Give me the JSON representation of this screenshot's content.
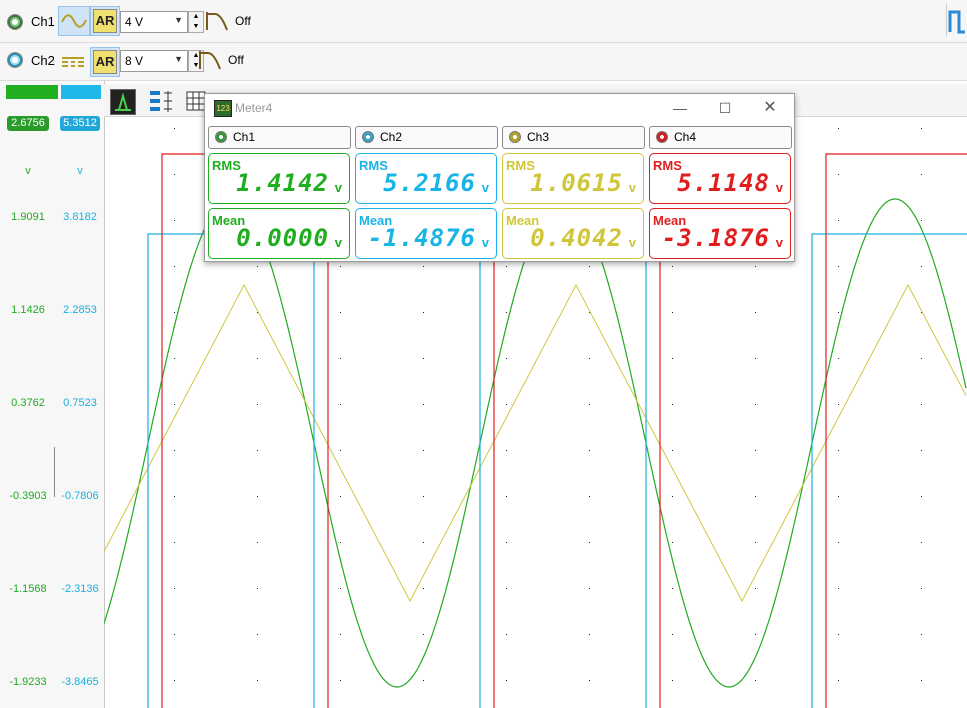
{
  "channel_controls": [
    {
      "name": "Ch1",
      "voltage": "4 V",
      "filter": "Off",
      "ar": "AR"
    },
    {
      "name": "Ch2",
      "voltage": "8 V",
      "filter": "Off",
      "ar": "AR"
    }
  ],
  "scale_panel": {
    "ch1_value": "2.6756",
    "ch2_value": "5.3512",
    "ch1_unit": "v",
    "ch2_unit": "v",
    "ch1_ticks": [
      "1.9091",
      "1.1426",
      "0.3762",
      "-0.3903",
      "-1.1568",
      "-1.9233"
    ],
    "ch2_ticks": [
      "3.8182",
      "2.2853",
      "0.7523",
      "-0.7806",
      "-2.3136",
      "-3.8465"
    ],
    "ch1_color": "#22aa22",
    "ch2_color": "#1ab0e0"
  },
  "meter": {
    "title": "Meter4",
    "channels": [
      {
        "label": "Ch1",
        "color": "#1fae1f",
        "led": "#3a9a3a",
        "rms_label": "RMS",
        "rms": "1.4142",
        "mean_label": "Mean",
        "mean": "0.0000",
        "unit": "v"
      },
      {
        "label": "Ch2",
        "color": "#19b4e6",
        "led": "#3aa0c0",
        "rms_label": "RMS",
        "rms": "5.2166",
        "mean_label": "Mean",
        "mean": "-1.4876",
        "unit": "v"
      },
      {
        "label": "Ch3",
        "color": "#d0c63a",
        "led": "#b0a030",
        "rms_label": "RMS",
        "rms": "1.0615",
        "mean_label": "Mean",
        "mean": "0.4042",
        "unit": "v"
      },
      {
        "label": "Ch4",
        "color": "#e01e1e",
        "led": "#d02020",
        "rms_label": "RMS",
        "rms": "5.1148",
        "mean_label": "Mean",
        "mean": "-3.1876",
        "unit": "v"
      }
    ]
  },
  "icons": {
    "minimize": "minimize-icon",
    "maximize": "maximize-icon",
    "close": "close-icon",
    "sine": "sine-wave-icon",
    "filter": "lowpass-filter-icon"
  },
  "colors": {
    "ch1": "#22aa22",
    "ch2": "#1ab0e0",
    "ch3": "#d0c63a",
    "ch4": "#e01e1e"
  }
}
